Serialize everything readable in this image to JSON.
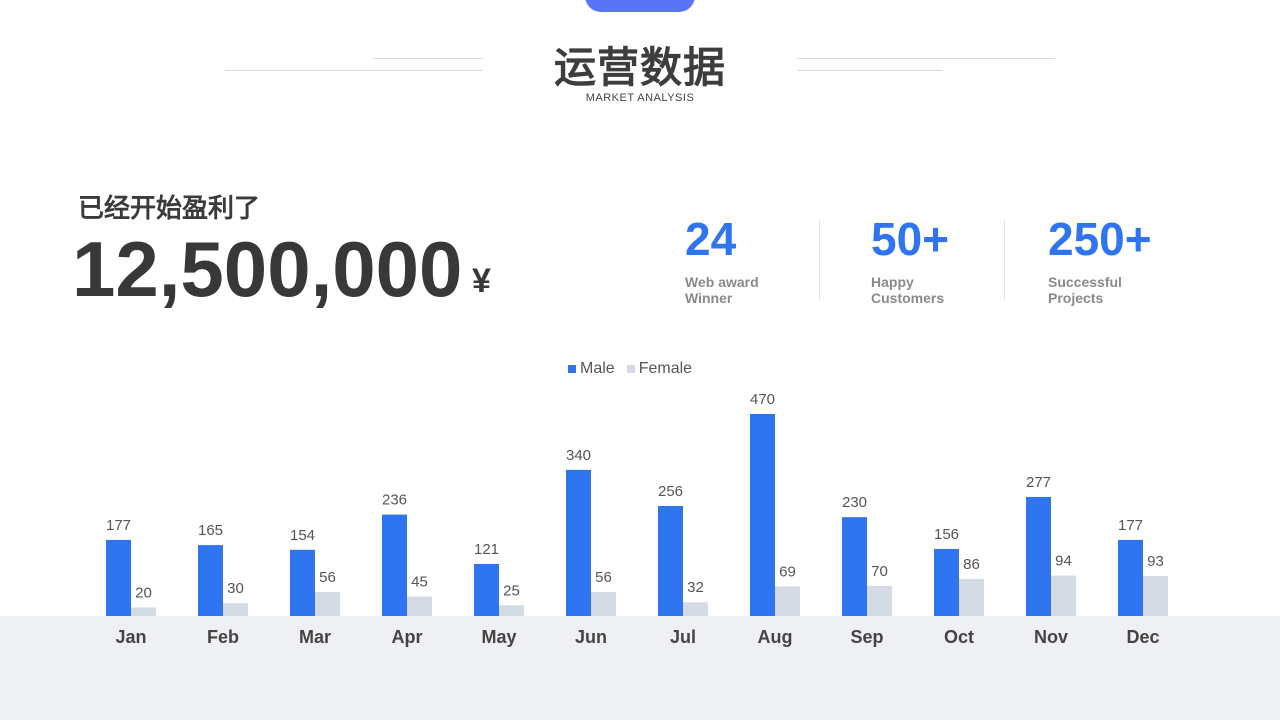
{
  "header": {
    "title": "运营数据",
    "subtitle": "MARKET ANALYSIS"
  },
  "profit": {
    "label": "已经开始盈利了",
    "amount": "12,500,000",
    "currency": "¥"
  },
  "stats": [
    {
      "value": "24",
      "label_line1": "Web award",
      "label_line2": "Winner"
    },
    {
      "value": "50+",
      "label_line1": "Happy",
      "label_line2": "Customers"
    },
    {
      "value": "250+",
      "label_line1": "Successful",
      "label_line2": "Projects"
    }
  ],
  "colors": {
    "accent": "#2f74f0",
    "male": "#2f74f0",
    "female": "#d5dbe5",
    "tab": "#5b73f5",
    "floor": "#eff0f3"
  },
  "chart_data": {
    "type": "bar",
    "categories": [
      "Jan",
      "Feb",
      "Mar",
      "Apr",
      "May",
      "Jun",
      "Jul",
      "Aug",
      "Sep",
      "Oct",
      "Nov",
      "Dec"
    ],
    "series": [
      {
        "name": "Male",
        "values": [
          177,
          165,
          154,
          236,
          121,
          340,
          256,
          470,
          230,
          156,
          277,
          177
        ]
      },
      {
        "name": "Female",
        "values": [
          20,
          30,
          56,
          45,
          25,
          56,
          32,
          69,
          70,
          86,
          94,
          93
        ]
      }
    ],
    "ylim": [
      0,
      470
    ],
    "legend": "top-center",
    "grid": false
  }
}
